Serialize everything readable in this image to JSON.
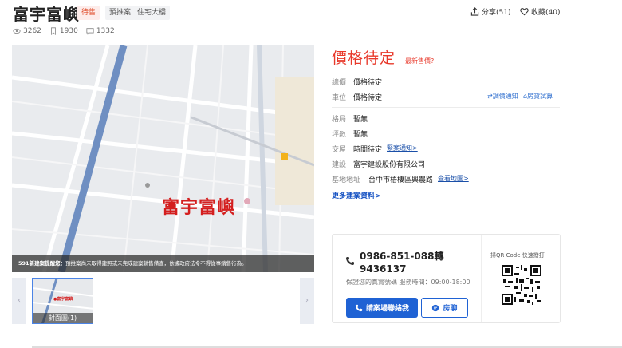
{
  "header": {
    "title": "富宇富嶼",
    "tags": [
      "待售",
      "預推案",
      "住宅大樓"
    ],
    "share_label": "分享(51)",
    "favorite_label": "收藏(40)"
  },
  "stats": {
    "views": "3262",
    "saves": "1930",
    "comments": "1332"
  },
  "gallery": {
    "map_label": "富宇富嶼",
    "notice_title": "591新建案提醒您：",
    "notice_text": "預推案尚未取得建照或未完成建案銷售備查，依據政府法令不得從事銷售行為。",
    "thumb_caption": "封面圖(1)",
    "thumb_mini_label": "●富宇富嶼",
    "prev_arrow": "‹",
    "next_arrow": "›"
  },
  "info": {
    "price": "價格待定",
    "price_link": "最新售價?",
    "rows": [
      {
        "label": "總價",
        "value": "價格待定"
      },
      {
        "label": "車位",
        "value": "價格待定"
      },
      {
        "label": "格局",
        "value": "暫無"
      },
      {
        "label": "坪數",
        "value": "暫無"
      },
      {
        "label": "交屋",
        "value": "時間待定",
        "link": "緊案通知>"
      },
      {
        "label": "建設",
        "value": "富宇建設股份有限公司"
      },
      {
        "label": "基地地址",
        "value": "台中市梧棲區興農路",
        "link": "查看地圖>"
      }
    ],
    "tools": [
      "⇄調價通知",
      "⌂房貸試算"
    ],
    "more_link": "更多建案資料>"
  },
  "contact": {
    "phone": "0986-851-088轉9436137",
    "note": "保證您的真實號碼 服務時間：09:00-18:00",
    "call_button": "請案場聯絡我",
    "chat_button": "房聊",
    "qr_caption": "掃QR Code 快速撥打"
  },
  "colors": {
    "accent_red": "#e8382a",
    "brand_blue": "#1f62d4"
  }
}
